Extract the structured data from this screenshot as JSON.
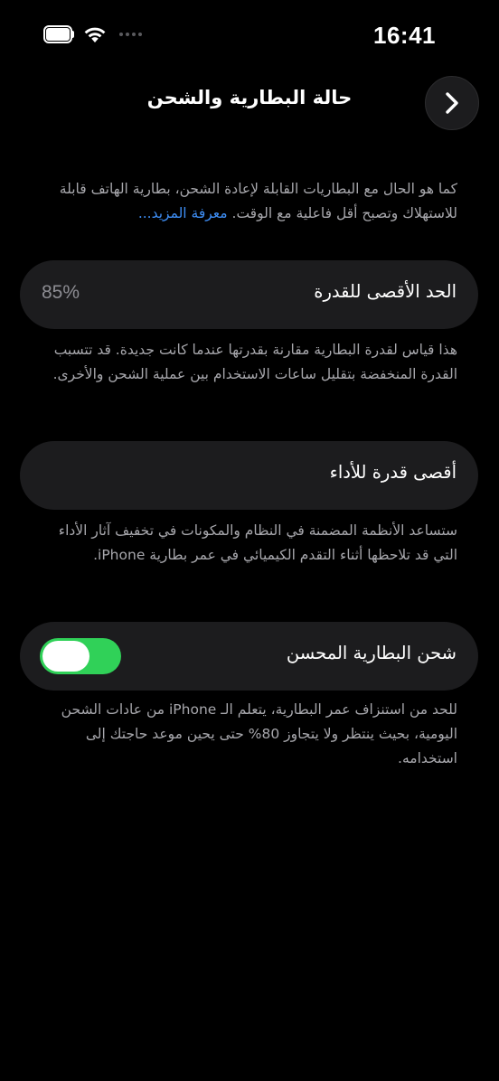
{
  "status_bar": {
    "time": "16:41",
    "icons": [
      "battery-icon",
      "wifi-icon",
      "cellular-signal-icon"
    ]
  },
  "nav": {
    "title": "حالة البطارية والشحن",
    "back_icon": "chevron-right-icon"
  },
  "intro": {
    "text": "كما هو الحال مع البطاريات القابلة لإعادة الشحن، بطارية الهاتف قابلة للاستهلاك وتصبح أقل فاعلية مع الوقت.",
    "link": "معرفة المزيد..."
  },
  "max_capacity": {
    "label": "الحد الأقصى للقدرة",
    "value": "85%",
    "description": "هذا قياس لقدرة البطارية مقارنة بقدرتها عندما كانت جديدة. قد تتسبب القدرة المنخفضة بتقليل ساعات الاستخدام بين عملية الشحن والأخرى."
  },
  "peak_performance": {
    "label": "أقصى قدرة للأداء",
    "description": "ستساعد الأنظمة المضمنة في النظام والمكونات في تخفيف آثار الأداء التي قد تلاحظها أثناء التقدم الكيميائي في عمر بطارية iPhone."
  },
  "optimized_charging": {
    "label": "شحن البطارية المحسن",
    "enabled": true,
    "description": "للحد من استنزاف عمر البطارية، يتعلم الـ iPhone من عادات الشحن اليومية، بحيث ينتظر ولا يتجاوز 80% حتى يحين موعد حاجتك إلى استخدامه."
  },
  "colors": {
    "background": "#000000",
    "cell": "#1c1c1e",
    "secondary_text": "#a7a7ac",
    "link": "#3e8ef5",
    "toggle_on": "#30d158"
  }
}
